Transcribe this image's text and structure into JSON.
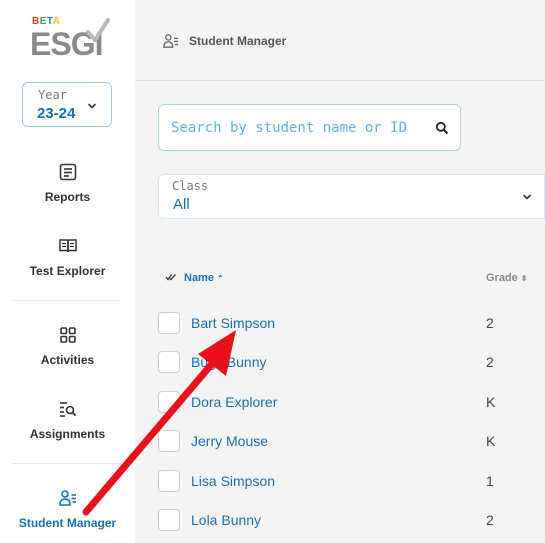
{
  "logo": {
    "beta": "BETA",
    "brand": "ESGI"
  },
  "year": {
    "label": "Year",
    "value": "23-24"
  },
  "nav": [
    {
      "label": "Reports",
      "icon": "reports-icon"
    },
    {
      "label": "Test Explorer",
      "icon": "book-icon"
    },
    {
      "label": "Activities",
      "icon": "grid-icon"
    },
    {
      "label": "Assignments",
      "icon": "assignments-search-icon"
    },
    {
      "label": "Student Manager",
      "icon": "student-manager-icon",
      "active": true
    }
  ],
  "breadcrumb": {
    "label": "Student Manager"
  },
  "search": {
    "placeholder": "Search by student name or ID"
  },
  "class_filter": {
    "label": "Class",
    "value": "All"
  },
  "table": {
    "headers": {
      "name": "Name",
      "grade": "Grade"
    },
    "rows": [
      {
        "name": "Bart Simpson",
        "grade": "2"
      },
      {
        "name": "Bugs Bunny",
        "grade": "2"
      },
      {
        "name": "Dora Explorer",
        "grade": "K"
      },
      {
        "name": "Jerry Mouse",
        "grade": "K"
      },
      {
        "name": "Lisa Simpson",
        "grade": "1"
      },
      {
        "name": "Lola Bunny",
        "grade": "2"
      }
    ]
  },
  "colors": {
    "accent": "#1a6fb3",
    "annotation": "#e8101a",
    "background": "#f4f4f4"
  }
}
